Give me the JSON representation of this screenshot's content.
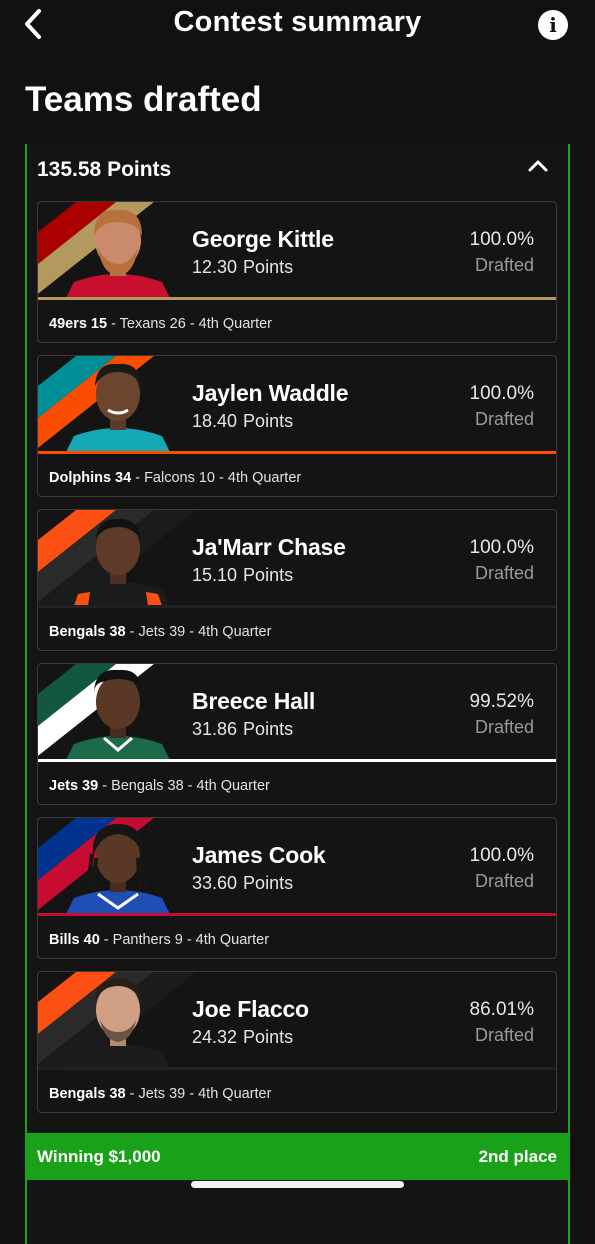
{
  "header": {
    "title": "Contest summary"
  },
  "section_title": "Teams drafted",
  "panel": {
    "total_points": "135.58 Points"
  },
  "players": [
    {
      "name": "George Kittle",
      "points": "12.30",
      "points_unit": "Points",
      "pct": "100.0%",
      "pct_label": "Drafted",
      "game_team": "49ers 15",
      "game_rest": " - Texans 26 - 4th Quarter",
      "team": "49ers",
      "colors": {
        "primary": "#aa0000",
        "secondary": "#b3995d",
        "jersey": "#c8102e",
        "divider": "#b3995d"
      }
    },
    {
      "name": "Jaylen Waddle",
      "points": "18.40",
      "points_unit": "Points",
      "pct": "100.0%",
      "pct_label": "Drafted",
      "game_team": "Dolphins 34",
      "game_rest": " - Falcons 10 - 4th Quarter",
      "team": "Dolphins",
      "colors": {
        "primary": "#008e97",
        "secondary": "#fc4c02",
        "jersey": "#14a9b4",
        "divider": "#fc4c02"
      }
    },
    {
      "name": "Ja'Marr Chase",
      "points": "15.10",
      "points_unit": "Points",
      "pct": "100.0%",
      "pct_label": "Drafted",
      "game_team": "Bengals 38",
      "game_rest": " - Jets 39 - 4th Quarter",
      "team": "Bengals",
      "colors": {
        "primary": "#fb4f14",
        "secondary": "#2a2a2a",
        "jersey": "#1c1c1c",
        "divider": "#222222"
      }
    },
    {
      "name": "Breece Hall",
      "points": "31.86",
      "points_unit": "Points",
      "pct": "99.52%",
      "pct_label": "Drafted",
      "game_team": "Jets 39",
      "game_rest": " - Bengals 38 - 4th Quarter",
      "team": "Jets",
      "colors": {
        "primary": "#125740",
        "secondary": "#ffffff",
        "jersey": "#1b6b4a",
        "divider": "#ffffff"
      }
    },
    {
      "name": "James Cook",
      "points": "33.60",
      "points_unit": "Points",
      "pct": "100.0%",
      "pct_label": "Drafted",
      "game_team": "Bills 40",
      "game_rest": " - Panthers 9 - 4th Quarter",
      "team": "Bills",
      "colors": {
        "primary": "#00338d",
        "secondary": "#c60c30",
        "jersey": "#1f4fb5",
        "divider": "#c60c30"
      }
    },
    {
      "name": "Joe Flacco",
      "points": "24.32",
      "points_unit": "Points",
      "pct": "86.01%",
      "pct_label": "Drafted",
      "game_team": "Bengals 38",
      "game_rest": " - Jets 39 - 4th Quarter",
      "team": "Bengals",
      "colors": {
        "primary": "#fb4f14",
        "secondary": "#2a2a2a",
        "jersey": "#1c1c1c",
        "divider": "#222222"
      }
    }
  ],
  "footer": {
    "winning": "Winning $1,000",
    "place": "2nd place"
  },
  "icons": {
    "back": "chevron-left-icon",
    "info": "info-icon",
    "collapse": "chevron-up-icon"
  }
}
